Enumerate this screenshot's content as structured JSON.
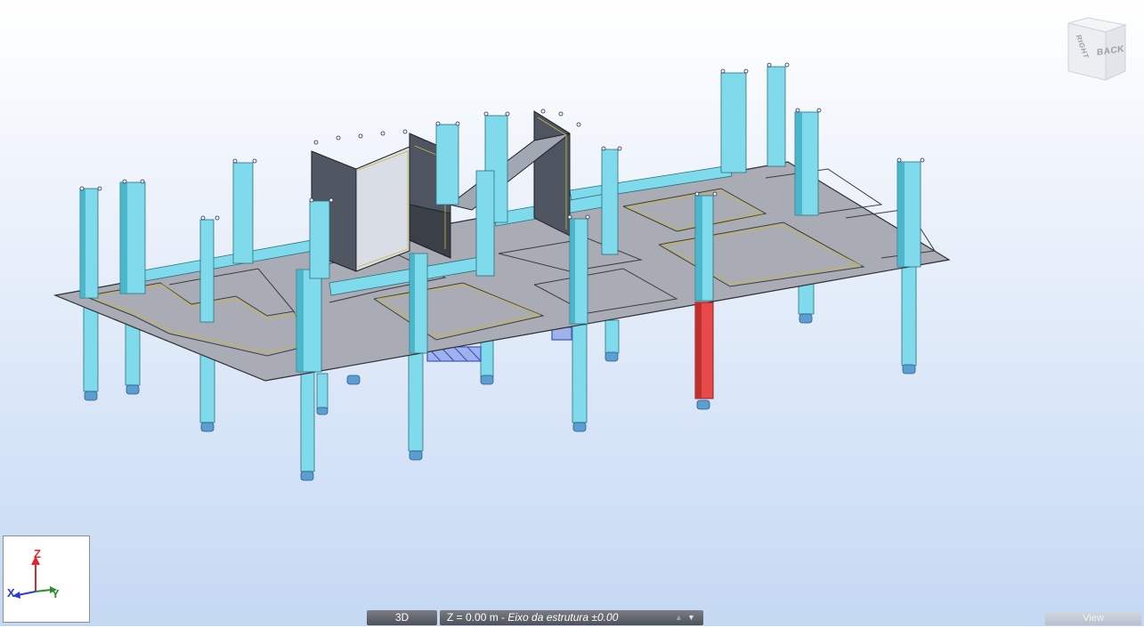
{
  "view_cube": {
    "right_label": "RIGHT",
    "back_label": "BACK"
  },
  "axes": {
    "z": "Z",
    "x": "X",
    "y": "Y"
  },
  "status_bar": {
    "view_mode": "3D",
    "level_value": "Z = 0.00 m",
    "level_separator": " - ",
    "level_description": "Eixo da estrutura ±0.00",
    "view_button": "View"
  },
  "colors": {
    "column": "#7fdaec",
    "column_dark": "#36a6bd",
    "beam": "#7fdaec",
    "slab": "#a9acb4",
    "slab_edge": "#3b3c40",
    "wall": "#505762",
    "selected_column": "#e84a4a",
    "panel_outline": "#c9b83a"
  }
}
